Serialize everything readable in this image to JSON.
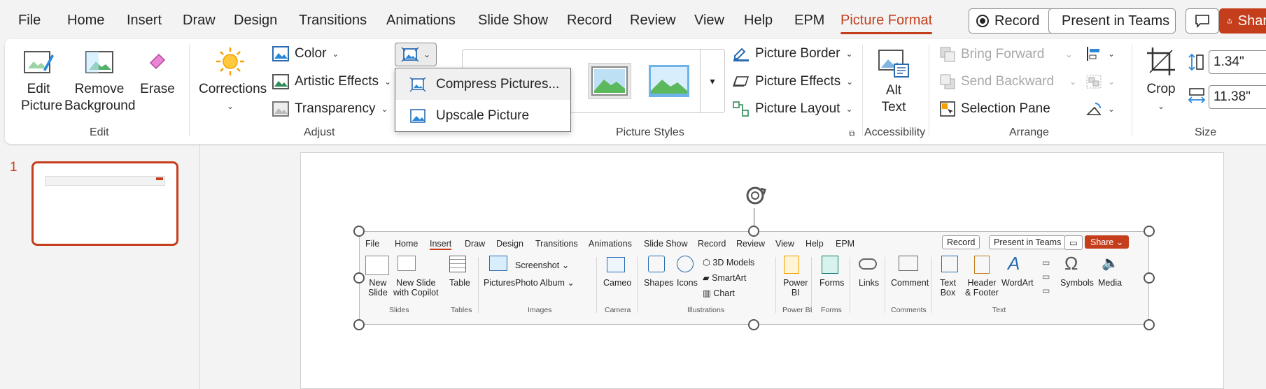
{
  "menubar": {
    "items": [
      "File",
      "Home",
      "Insert",
      "Draw",
      "Design",
      "Transitions",
      "Animations",
      "Slide Show",
      "Record",
      "Review",
      "View",
      "Help",
      "EPM",
      "Picture Format"
    ],
    "active": "Picture Format",
    "record": "Record",
    "present": "Present in Teams",
    "share": "Shar"
  },
  "ribbon": {
    "edit": {
      "edit_picture": [
        "Edit",
        "Picture"
      ],
      "remove_background": [
        "Remove",
        "Background"
      ],
      "erase": "Erase",
      "label": "Edit"
    },
    "adjust": {
      "corrections": "Corrections",
      "color": "Color",
      "artistic": "Artistic Effects",
      "transparency": "Transparency",
      "label": "Adjust"
    },
    "styles": {
      "label": "Picture Styles",
      "border": "Picture Border",
      "effects": "Picture Effects",
      "layout": "Picture Layout"
    },
    "accessibility": {
      "alt_text": [
        "Alt",
        "Text"
      ],
      "label": "Accessibility"
    },
    "arrange": {
      "bring_forward": "Bring Forward",
      "send_backward": "Send Backward",
      "selection_pane": "Selection Pane",
      "label": "Arrange"
    },
    "size": {
      "crop": "Crop",
      "height": "1.34\"",
      "width": "11.38\"",
      "label": "Size"
    }
  },
  "dropdown": {
    "compress": "Compress Pictures...",
    "upscale": "Upscale Picture"
  },
  "thumbnails": {
    "slide_number": "1"
  },
  "inner": {
    "menu": [
      "File",
      "Home",
      "Insert",
      "Draw",
      "Design",
      "Transitions",
      "Animations",
      "Slide Show",
      "Record",
      "Review",
      "View",
      "Help",
      "EPM"
    ],
    "record": "Record",
    "present": "Present in Teams",
    "share": "Share",
    "new_slide": [
      "New",
      "Slide"
    ],
    "new_slide_copilot": [
      "New Slide",
      "with Copilot"
    ],
    "table": "Table",
    "pictures": "Pictures",
    "screenshot": "Screenshot",
    "photo_album": "Photo Album",
    "cameo": "Cameo",
    "shapes": "Shapes",
    "icons": "Icons",
    "models": "3D Models",
    "smartart": "SmartArt",
    "chart": "Chart",
    "powerbi": [
      "Power",
      "BI"
    ],
    "forms": "Forms",
    "links": "Links",
    "comment": "Comment",
    "textbox": [
      "Text",
      "Box"
    ],
    "header_footer": [
      "Header",
      "& Footer"
    ],
    "wordart": "WordArt",
    "symbols": "Symbols",
    "media": "Media",
    "groups": {
      "slides": "Slides",
      "tables": "Tables",
      "images": "Images",
      "camera": "Camera",
      "illustrations": "Illustrations",
      "powerbi": "Power BI",
      "forms": "Forms",
      "comments": "Comments",
      "text": "Text"
    }
  }
}
